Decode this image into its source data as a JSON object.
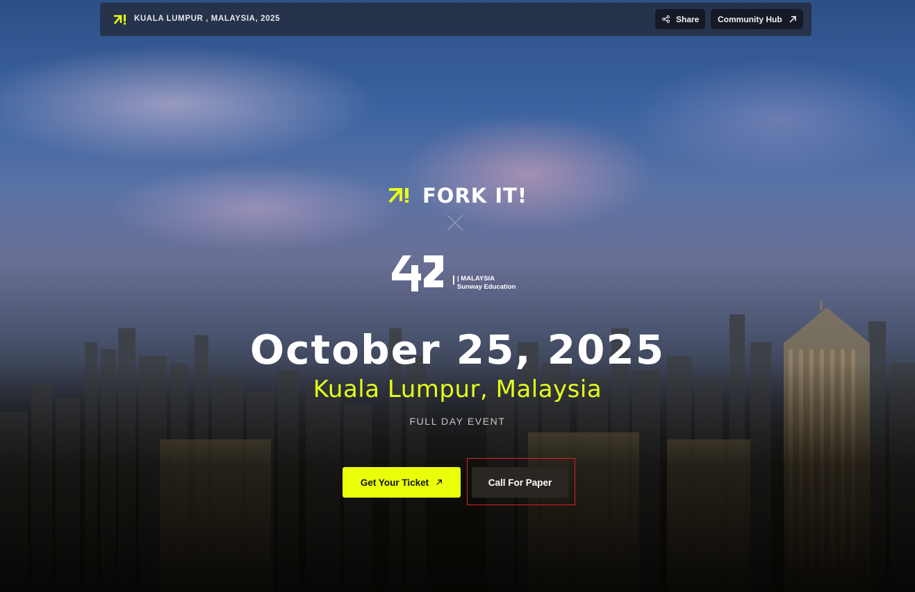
{
  "topbar": {
    "location": "KUALA LUMPUR , MALAYSIA, 2025",
    "share_label": "Share",
    "community_hub_label": "Community Hub"
  },
  "hero": {
    "brand_name": "FORK IT!",
    "partner_line1": "| MALAYSIA",
    "partner_line2": "Sunway Education",
    "date": "October 25, 2025",
    "city": "Kuala Lumpur, Malaysia",
    "event_type": "FULL DAY EVENT"
  },
  "actions": {
    "ticket_label": "Get Your Ticket",
    "cfp_label": "Call For Paper"
  },
  "colors": {
    "accent": "#eaff0a",
    "city_text": "#e6ff1a",
    "highlight_border": "#d8252a"
  },
  "icons": {
    "brand": "fork-it-arrow-logo-icon",
    "share": "share-icon",
    "external": "arrow-up-right-icon",
    "cross": "close-x-icon"
  }
}
